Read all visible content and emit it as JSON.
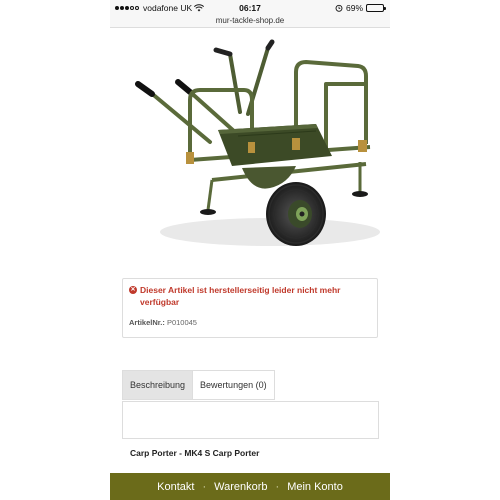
{
  "status_bar": {
    "signal_strength_bars": 3,
    "signal_total_bars": 5,
    "carrier": "vodafone UK",
    "wifi_icon": "wifi-icon",
    "time": "06:17",
    "alarm_icon": "alarm-icon",
    "battery_percent": "69%",
    "battery_level": 0.69
  },
  "browser": {
    "url": "mur-tackle-shop.de"
  },
  "product": {
    "image_alt": "product-image",
    "notice": "Dieser Artikel ist herstellerseitig leider nicht mehr verfügbar",
    "article_label": "ArtikelNr.:",
    "article_number": "P010045",
    "title": "Carp Porter - MK4 S Carp Porter"
  },
  "tabs": [
    {
      "label": "Beschreibung",
      "active": true
    },
    {
      "label": "Bewertungen (0)",
      "active": false
    }
  ],
  "bottom_nav": {
    "items": [
      "Kontakt",
      "Warenkorb",
      "Mein Konto"
    ],
    "separator": "·"
  },
  "colors": {
    "accent": "#6b6b1a",
    "error": "#c0392b",
    "frame_green": "#5a6a3a"
  }
}
